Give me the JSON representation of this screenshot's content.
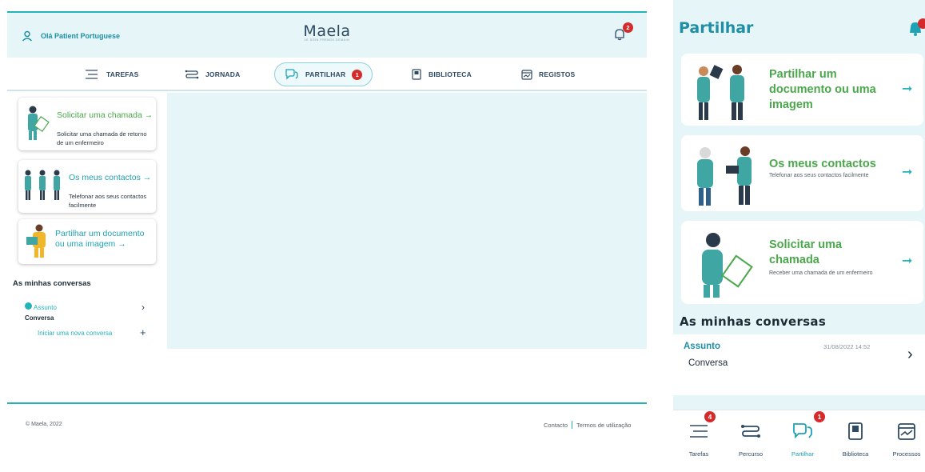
{
  "desktop": {
    "header": {
      "greeting": "Olá Patient Portuguese",
      "logo_text": "Maela",
      "logo_tagline": "LE SOIN PRENDS DEMAIN",
      "notifications_count": "2"
    },
    "nav": {
      "tarefas": "TAREFAS",
      "jornada": "JORNADA",
      "partilhar": "PARTILHAR",
      "partilhar_badge": "1",
      "biblioteca": "BIBLIOTECA",
      "registos": "REGISTOS"
    },
    "cards": {
      "call_title": "Solicitar uma chamada →",
      "call_sub": "Solicitar uma chamada de retorno de um enfermeiro",
      "contacts_title": "Os meus contactos →",
      "contacts_sub": "Telefonar aos seus contactos facilmente",
      "share_title": "Partilhar um documento ou uma imagem →"
    },
    "conversations": {
      "heading": "As minhas conversas",
      "items": [
        {
          "subject": "Assunto",
          "name": "Conversa"
        }
      ],
      "new_conversation": "Iniciar uma nova conversa"
    },
    "footer": {
      "copyright": "© Maela, 2022",
      "contact": "Contacto",
      "terms": "Termos de utilização"
    }
  },
  "mobile": {
    "title": "Partilhar",
    "cards": {
      "share_title": "Partilhar um documento ou uma imagem",
      "contacts_title": "Os meus contactos",
      "contacts_sub": "Telefonar aos seus contactos facilmente",
      "call_title": "Solicitar uma chamada",
      "call_sub": "Receber uma chamada de um enfermeiro"
    },
    "conversations": {
      "heading": "As minhas conversas",
      "subject": "Assunto",
      "date": "31/08/2022 14:52",
      "name": "Conversa"
    },
    "tabbar": {
      "tarefas": "Tarefas",
      "tarefas_badge": "4",
      "percurso": "Percurso",
      "partilhar": "Partilhar",
      "partilhar_badge": "1",
      "biblioteca": "Biblioteca",
      "processos": "Processos"
    }
  },
  "colors": {
    "accent": "#25b3ba",
    "green_title": "#4aa84b",
    "header_bg": "#e6f5f7",
    "badge_red": "#d42a2a"
  }
}
